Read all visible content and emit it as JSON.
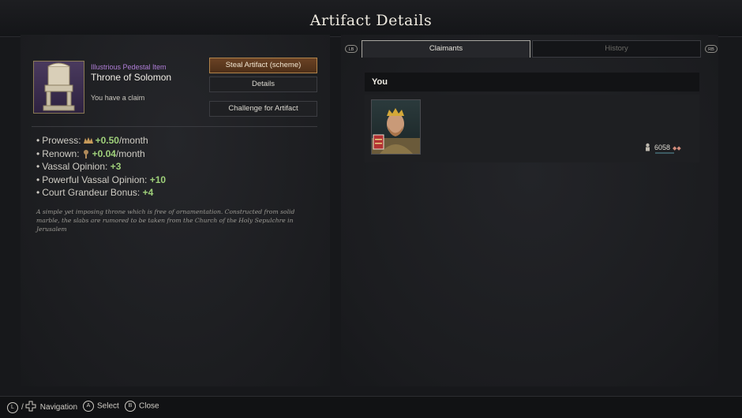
{
  "window": {
    "title": "Artifact Details"
  },
  "artifact": {
    "rarity_label": "Illustrious Pedestal Item",
    "name": "Throne of Solomon",
    "claim_status": "You have a claim",
    "actions": {
      "steal": "Steal Artifact (scheme)",
      "details": "Details",
      "challenge": "Challenge for Artifact"
    },
    "modifiers": [
      {
        "label": "Prowess:",
        "value": "+0.50",
        "suffix": "/month",
        "icon": "prowess-icon"
      },
      {
        "label": "Renown:",
        "value": "+0.04",
        "suffix": "/month",
        "icon": "renown-icon"
      },
      {
        "label": "Vassal Opinion:",
        "value": "+3",
        "suffix": ""
      },
      {
        "label": "Powerful Vassal Opinion:",
        "value": "+10",
        "suffix": ""
      },
      {
        "label": "Court Grandeur Bonus:",
        "value": "+4",
        "suffix": ""
      }
    ],
    "description": "A simple yet imposing throne which is free of ornamentation. Constructed from solid marble, the slabs are rumored to be taken from the Church of the Holy Sepulchre in Jerusalem"
  },
  "tabs": {
    "left_shoulder": "LB",
    "right_shoulder": "RB",
    "claimants": "Claimants",
    "history": "History"
  },
  "claimants": {
    "section_label": "You",
    "entries": [
      {
        "value": "6058",
        "icon": "soldier-icon"
      }
    ]
  },
  "footer": {
    "navigation": {
      "button": "L",
      "label": "Navigation"
    },
    "select": {
      "button": "A",
      "label": "Select"
    },
    "close": {
      "button": "B",
      "label": "Close"
    }
  },
  "colors": {
    "accent_button": "#6a4224",
    "positive_value": "#9fd07a",
    "rarity": "#b07ed8"
  }
}
